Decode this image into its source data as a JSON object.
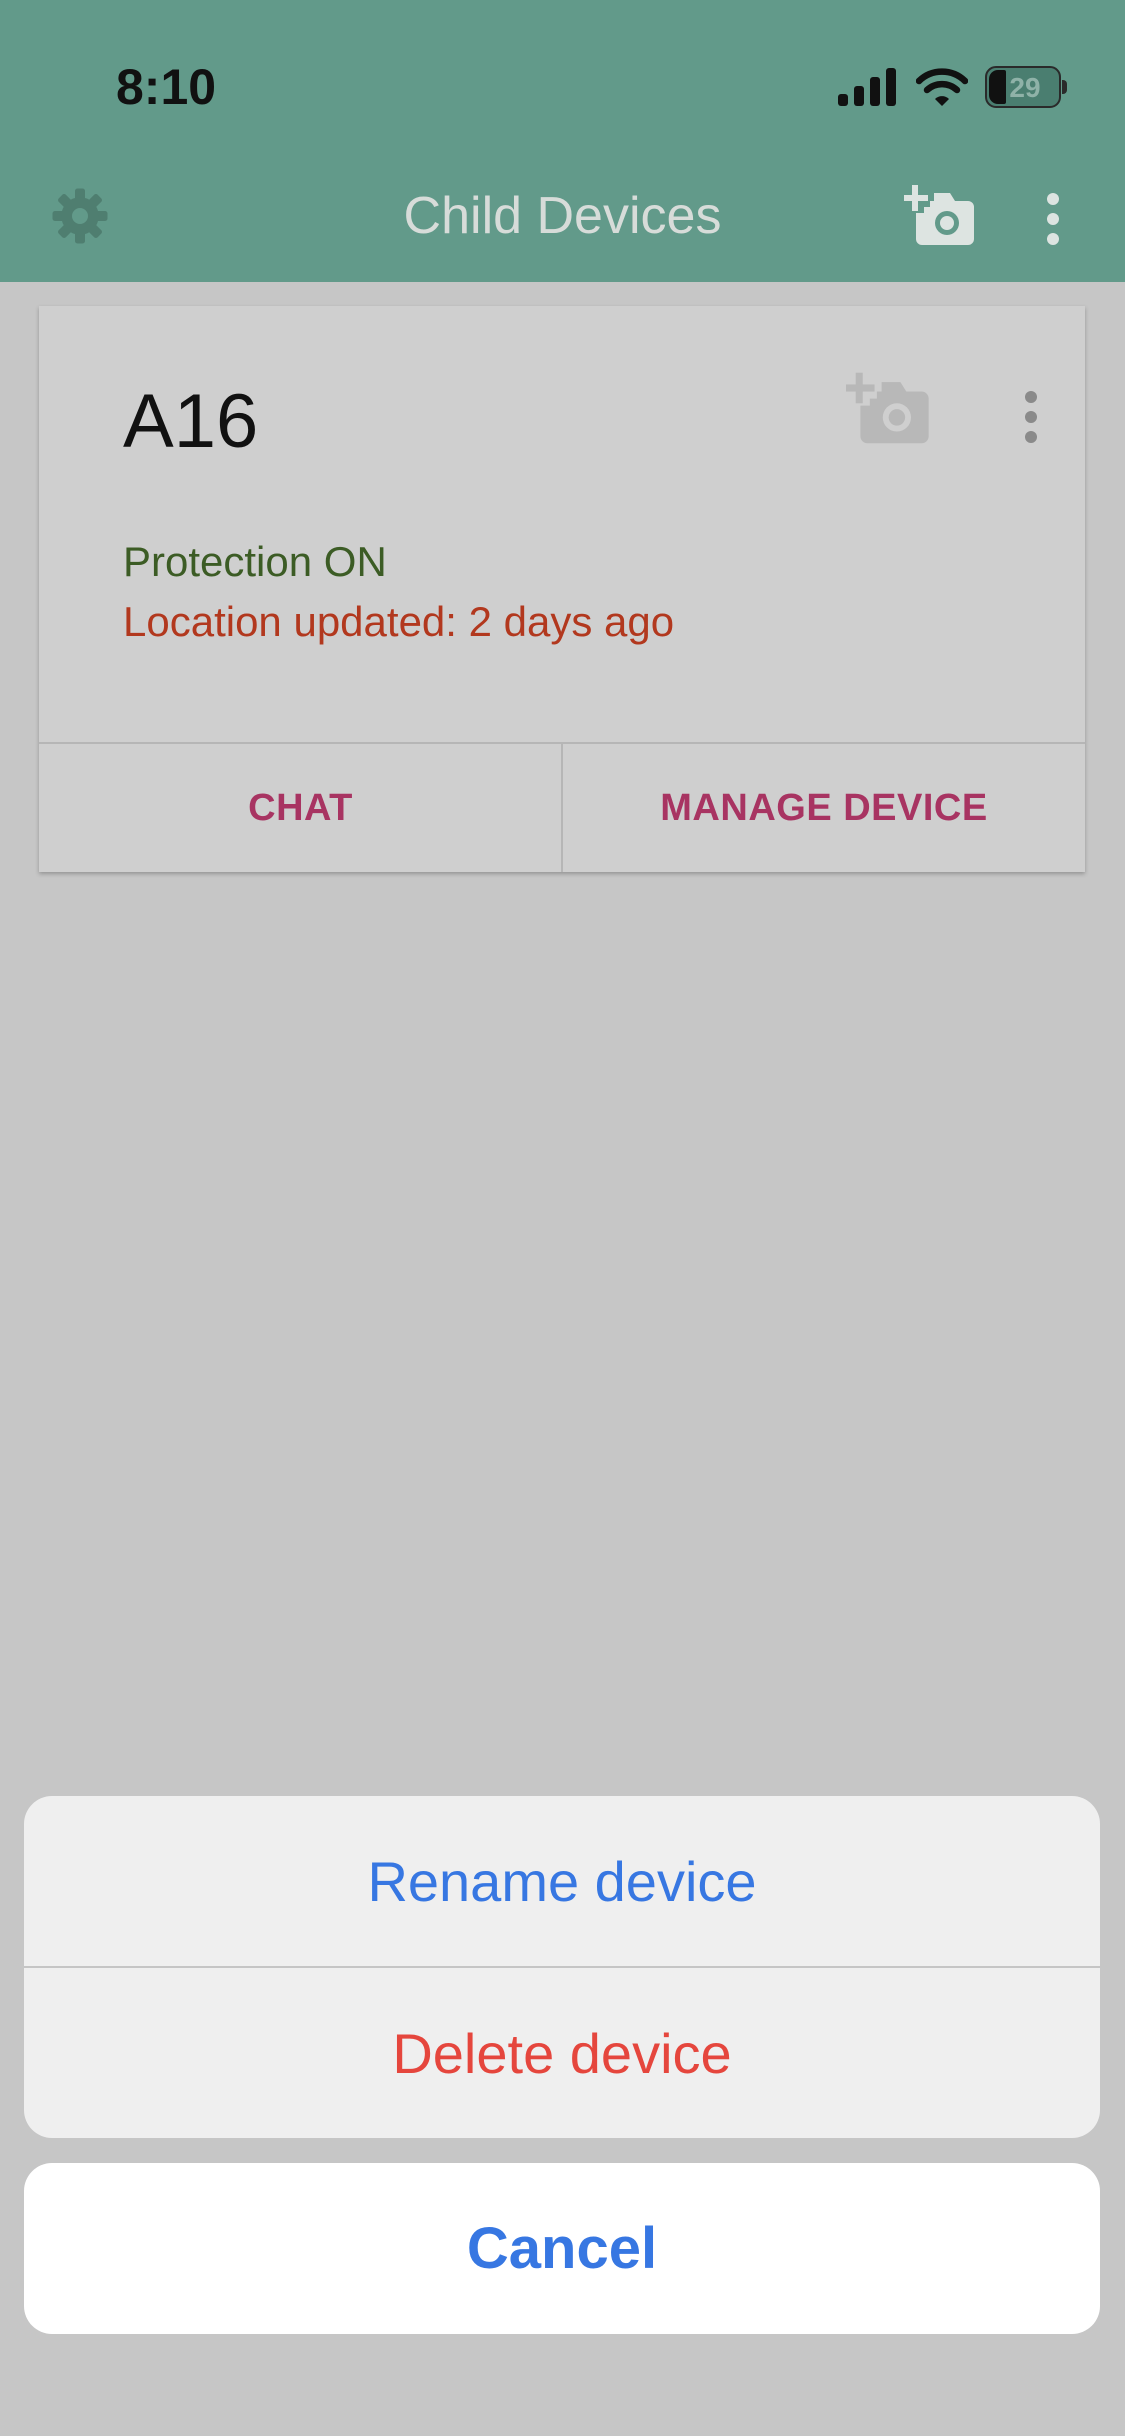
{
  "status_bar": {
    "time": "8:10",
    "battery_level": "29"
  },
  "app_bar": {
    "title": "Child Devices",
    "icons": [
      "gear-icon",
      "add-camera-icon",
      "more-vertical-icon"
    ]
  },
  "device_card": {
    "name": "A16",
    "protection_status": "Protection ON",
    "location_status": "Location updated: 2 days ago",
    "actions": {
      "chat": "CHAT",
      "manage": "MANAGE DEVICE"
    },
    "icons": [
      "add-camera-icon",
      "more-vertical-icon"
    ]
  },
  "action_sheet": {
    "options": {
      "rename": "Rename device",
      "delete": "Delete device"
    },
    "cancel": "Cancel"
  },
  "colors": {
    "app_bar": "#629a8a",
    "dim_overlay": "#c6c6c6",
    "protection_on": "#3c5c25",
    "location_stale": "#b2381e",
    "card_action": "#a83462",
    "ios_blue": "#3777e2",
    "ios_destructive": "#e5463d"
  }
}
